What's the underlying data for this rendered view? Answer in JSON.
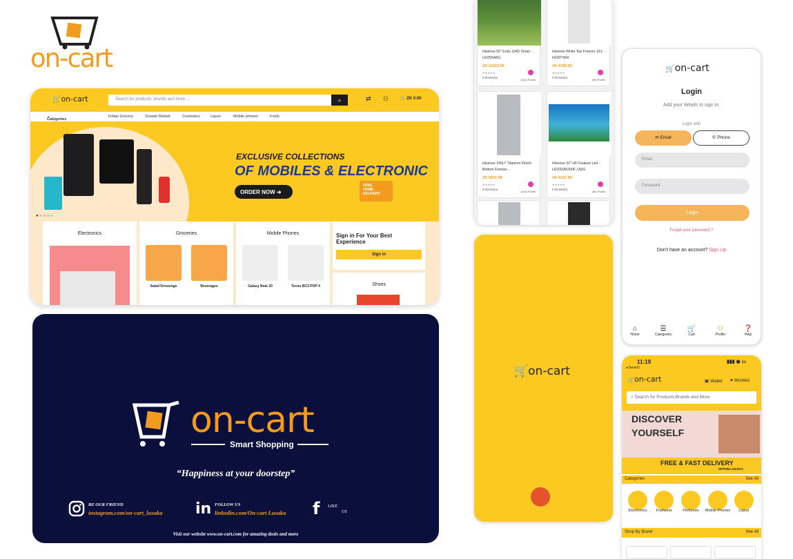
{
  "brand": {
    "name": "on-cart",
    "tagline": "Smart Shopping"
  },
  "web": {
    "search_placeholder": "Search for products, brands and more ...",
    "cart_total": "ZK 0.00",
    "cart_count": "0",
    "categories_label": "Categories",
    "nav": [
      "Indian Grocery",
      "Soweto Market",
      "Cosmetics",
      "Liquor",
      "Mobile phones",
      "Fruits"
    ],
    "hero": {
      "line1": "EXCLUSIVE COLLECTIONS",
      "line2": "OF MOBILES & ELECTRONIC",
      "cta": "ORDER NOW",
      "badge": "FREE HOME DELIVERY"
    },
    "tiles": {
      "electronics": "Electronics",
      "groceries": "Groceries",
      "groceries_items": [
        "Salad Dressings",
        "Beverages"
      ],
      "mobiles": "Mobile Phones",
      "mobiles_items": [
        "Galaxy Note 20",
        "Tecno BC3 POP 4"
      ],
      "signin_title": "Sign in For Your Best Experience",
      "signin_button": "Sign in",
      "shoes": "Shoes"
    }
  },
  "footer": {
    "quote": "“Happiness at your doorstep”",
    "instagram": {
      "title": "BE OUR FRIEND",
      "handle": "instagram.com/on-cart_lusaka"
    },
    "linkedin": {
      "title": "FOLLOW US",
      "handle": "linkedin.com/On-cart Lusaka"
    },
    "facebook": {
      "title": "LIKE",
      "sub": "US"
    },
    "website": "Visit our website www.on-cart.com for amazing deals and more"
  },
  "products": [
    {
      "name": "Hisense 55\" Entry UHD Smart - LED55A6G",
      "price": "ZK 12223.99",
      "reviews": "0 Review(s)",
      "points": "(244) Points",
      "img": "landscape"
    },
    {
      "name": "Hisense White Top Freezer 16'L - H220TWH",
      "price": "ZK 4782.99",
      "reviews": "0 Review(s)",
      "points": "(95) Points",
      "img": "fridge"
    },
    {
      "name": "Hisense 166LT Titanium Finish Bottom Freezer ...",
      "price": "ZK 5937.99",
      "reviews": "0 Review(s)",
      "points": "(119) Points",
      "img": "fridge"
    },
    {
      "name": "Hisense 32\" HD Feature Led - LED32A5200F / A3G",
      "price": "ZK 4197.99",
      "reviews": "0 Review(s)",
      "points": "(84) Points",
      "img": "landscape"
    }
  ],
  "login": {
    "title": "Login",
    "subtitle": "Add your details to sign in.",
    "login_with": "Login with",
    "email_tab": "Email",
    "phone_tab": "Phone",
    "email_placeholder": "Email",
    "password_placeholder": "Password",
    "button": "Login",
    "forgot": "Forget your password ?",
    "no_account": "Don't have an account?",
    "signup": "Sign Up",
    "tabs": [
      "Home",
      "Categories",
      "Cart",
      "Profile",
      "Help"
    ]
  },
  "home": {
    "time": "11:19",
    "back": "◂ Search",
    "wallet": "Wallet",
    "wishlist": "Wishlist",
    "search_placeholder": "Search for Products,Brands and More",
    "banner1": "DISCOVER",
    "banner2": "YOURSELF",
    "delivery": "FREE & FAST DELIVERY",
    "delivery_sub": "WITHIN LUSAKA",
    "categories_title": "Categories",
    "see_all": "See All",
    "categories": [
      "Electronics",
      "Footwear",
      "Perfumes",
      "Mobile Phones",
      "Liquor"
    ],
    "brand_title": "Shop By Brand"
  },
  "colors": {
    "yellow": "#fcc923",
    "orange": "#f39b1c",
    "navy": "#0b0f3b",
    "pink": "#e23fa8"
  }
}
